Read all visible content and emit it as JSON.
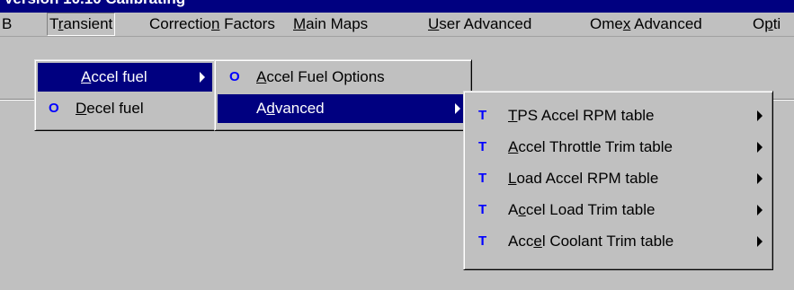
{
  "window": {
    "title": "Version 10.10 Calibrating"
  },
  "menubar": {
    "items": [
      {
        "pre": "",
        "ul": "",
        "post": "B"
      },
      {
        "pre": "T",
        "ul": "r",
        "post": "ansient"
      },
      {
        "pre": "Correctio",
        "ul": "n",
        "post": " Factors"
      },
      {
        "pre": "",
        "ul": "M",
        "post": "ain Maps"
      },
      {
        "pre": "",
        "ul": "U",
        "post": "ser Advanced"
      },
      {
        "pre": "Ome",
        "ul": "x",
        "post": " Advanced"
      },
      {
        "pre": "O",
        "ul": "p",
        "post": "ti"
      }
    ]
  },
  "transient_menu": {
    "items": [
      {
        "pre": "",
        "ul": "A",
        "post": "ccel fuel",
        "icon": "",
        "selected": true,
        "submenu": true
      },
      {
        "pre": "",
        "ul": "D",
        "post": "ecel fuel",
        "icon": "O",
        "selected": false,
        "submenu": false
      }
    ]
  },
  "accel_fuel_menu": {
    "items": [
      {
        "pre": "",
        "ul": "A",
        "post": "ccel Fuel Options",
        "icon": "O",
        "selected": false,
        "submenu": false
      },
      {
        "pre": "A",
        "ul": "d",
        "post": "vanced",
        "icon": "",
        "selected": true,
        "submenu": true
      }
    ]
  },
  "advanced_menu": {
    "items": [
      {
        "pre": "",
        "ul": "T",
        "post": "PS Accel RPM table",
        "icon": "T"
      },
      {
        "pre": "",
        "ul": "A",
        "post": "ccel Throttle Trim table",
        "icon": "T"
      },
      {
        "pre": "",
        "ul": "L",
        "post": "oad Accel RPM table",
        "icon": "T"
      },
      {
        "pre": "A",
        "ul": "c",
        "post": "cel Load Trim table",
        "icon": "T"
      },
      {
        "pre": "Acc",
        "ul": "e",
        "post": "l Coolant Trim table",
        "icon": "T"
      }
    ]
  },
  "colors": {
    "menu_bg": "#c0c0c0",
    "highlight": "#000080",
    "icon_blue": "#0000ff"
  }
}
